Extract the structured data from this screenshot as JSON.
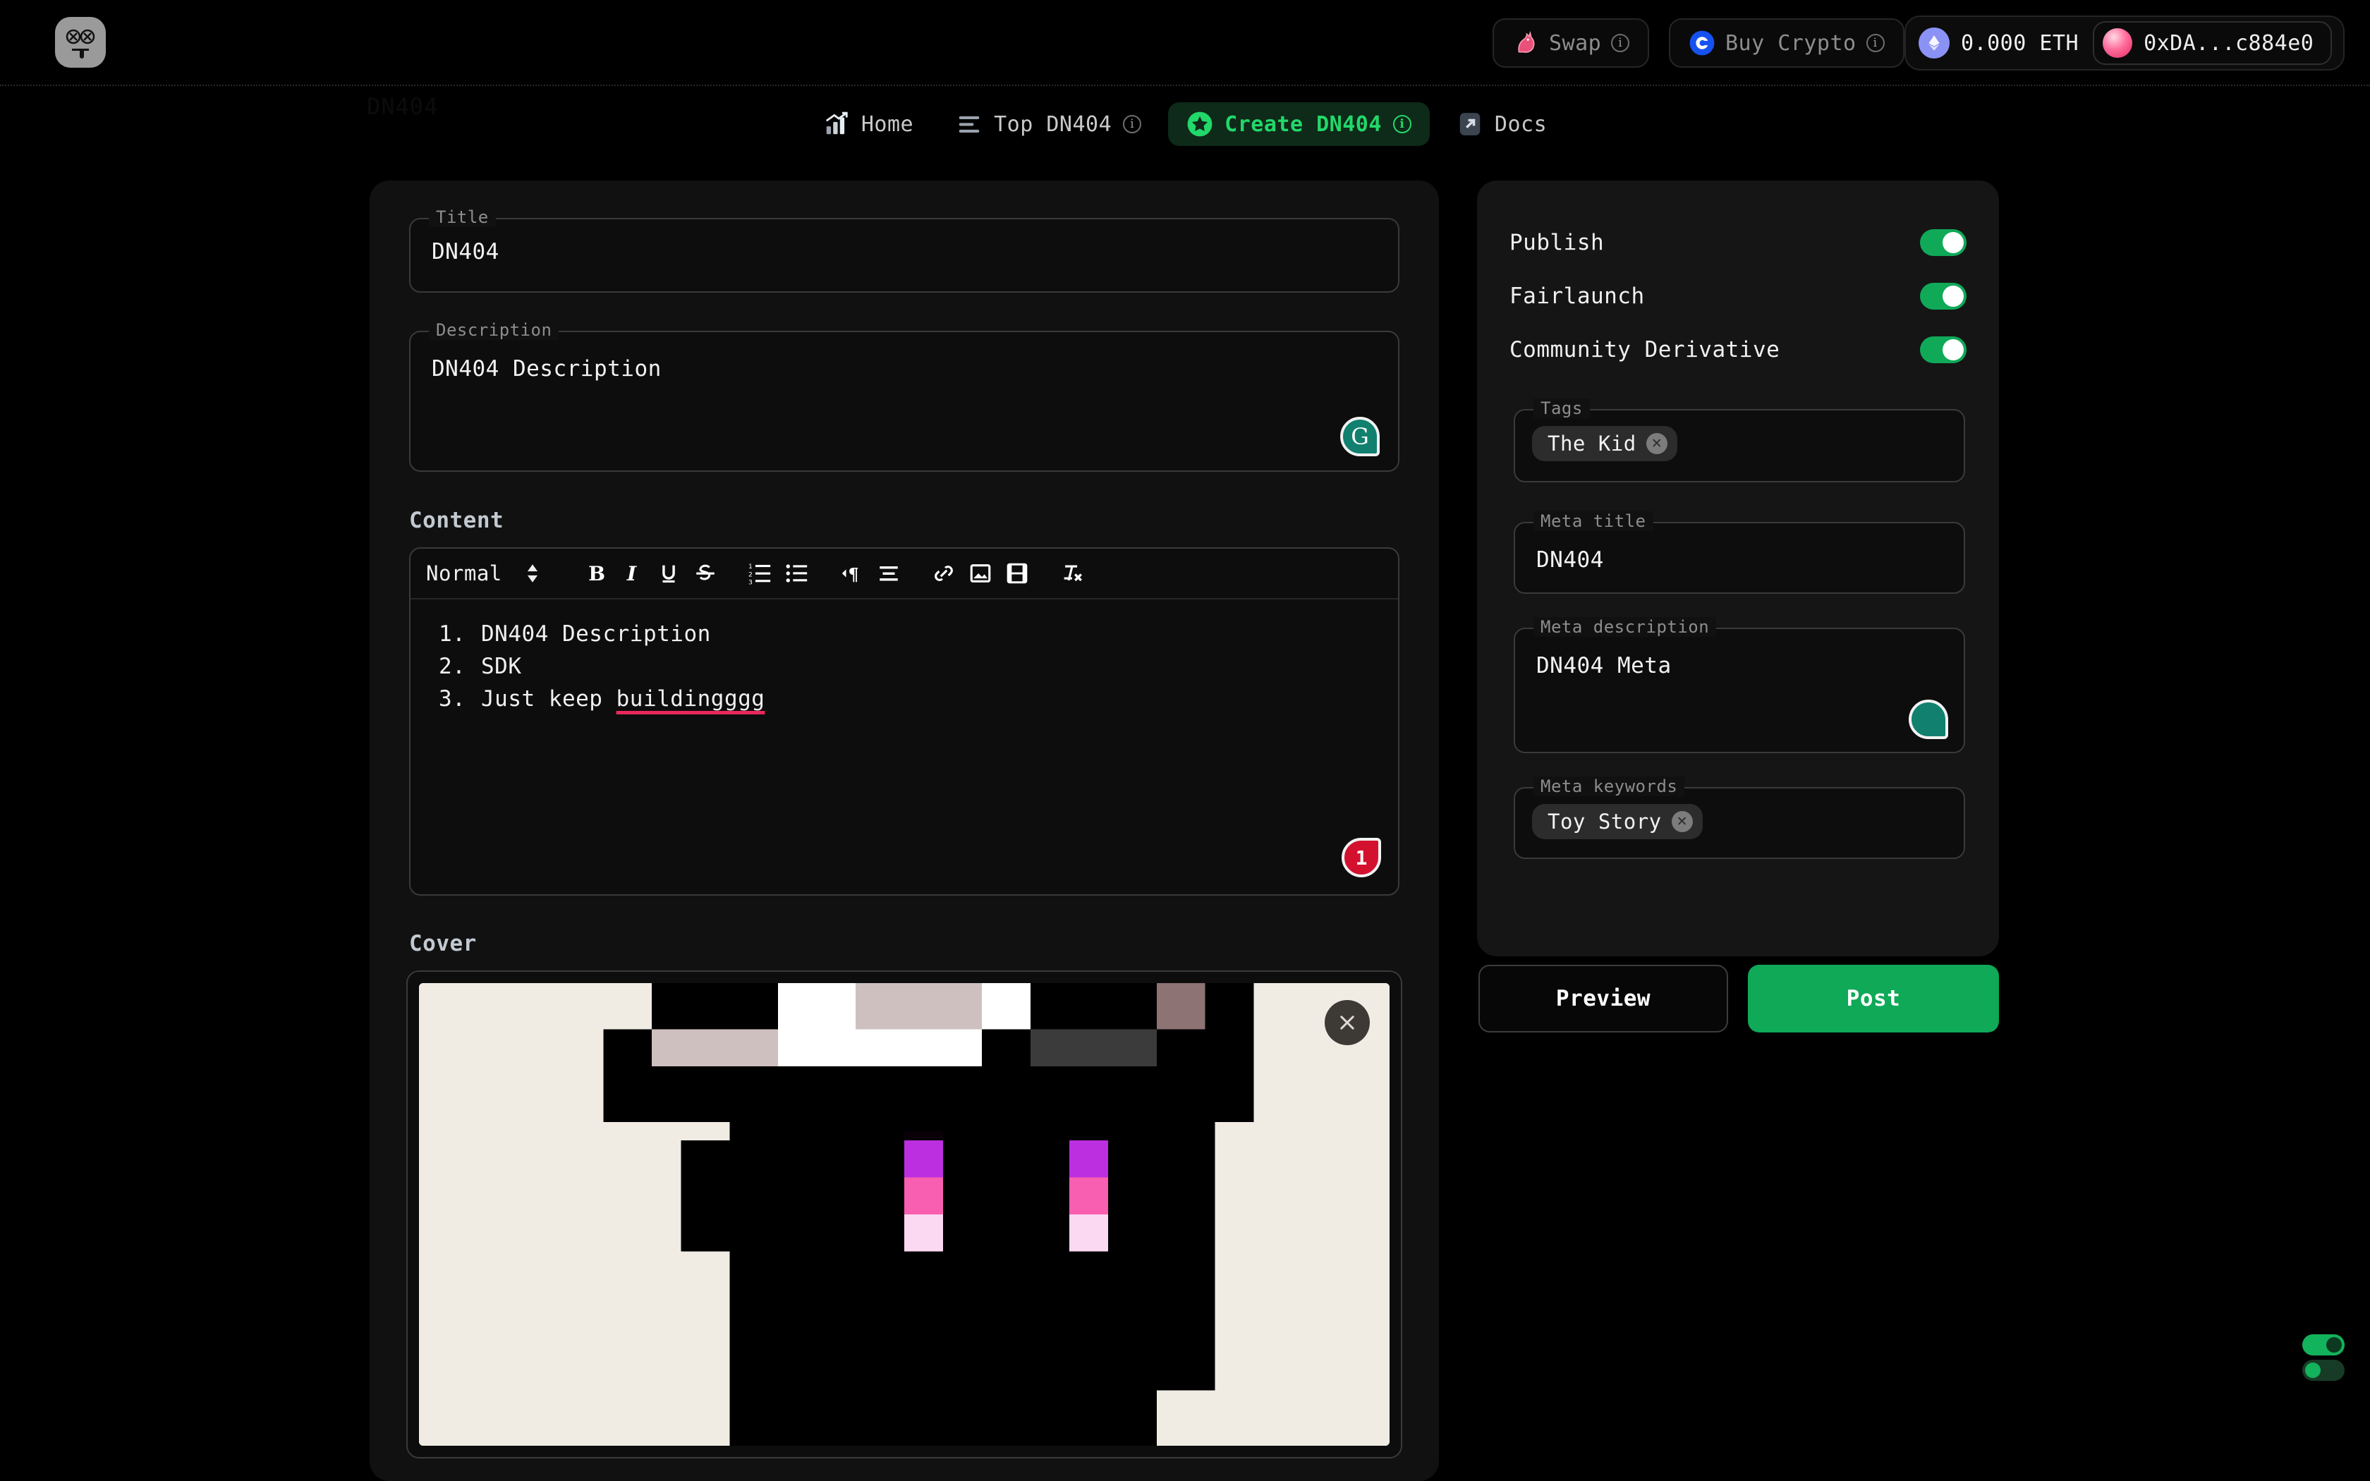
{
  "topbar": {
    "logo_icon": "dead-face-logo-icon",
    "swap": {
      "label": "Swap",
      "icon": "unicorn-icon",
      "info_icon": "info-icon"
    },
    "buy_crypto": {
      "label": "Buy Crypto",
      "icon": "coinbase-icon",
      "info_icon": "info-icon"
    },
    "wallet": {
      "balance": "0.000 ETH",
      "chain_icon": "ethereum-icon",
      "address": "0xDA...c884e0",
      "avatar_icon": "wallet-avatar"
    }
  },
  "nav": {
    "items": [
      {
        "label": "Home",
        "icon": "chart-up-icon",
        "active": false,
        "has_info": false
      },
      {
        "label": "Top DN404",
        "icon": "list-icon",
        "active": false,
        "has_info": true
      },
      {
        "label": "Create DN404",
        "icon": "star-badge-icon",
        "active": true,
        "has_info": true
      },
      {
        "label": "Docs",
        "icon": "external-link-icon",
        "active": false,
        "has_info": false
      }
    ]
  },
  "ghost_text": "DN404",
  "form": {
    "title": {
      "legend": "Title",
      "value": "DN404"
    },
    "description": {
      "legend": "Description",
      "value": "DN404 Description",
      "grammarly_icon": "grammarly-icon"
    },
    "content": {
      "label": "Content",
      "toolbar": {
        "style_select": "Normal",
        "style_caret_icon": "chevron-updown-icon",
        "buttons": [
          "bold-icon",
          "italic-icon",
          "underline-icon",
          "strikethrough-icon",
          "ordered-list-icon",
          "bullet-list-icon",
          "text-direction-icon",
          "align-icon",
          "link-icon",
          "image-icon",
          "video-icon",
          "clear-format-icon"
        ]
      },
      "items": [
        {
          "num": "1.",
          "text": "DN404 Description",
          "misspelled": ""
        },
        {
          "num": "2.",
          "text": "SDK",
          "misspelled": ""
        },
        {
          "num": "3.",
          "text": "Just keep ",
          "misspelled": "buildingggg"
        }
      ],
      "grammarly_count": "1"
    },
    "cover": {
      "label": "Cover",
      "remove_icon": "close-icon",
      "image_alt": "pixel-art-character-cover"
    }
  },
  "sidebar": {
    "toggles": [
      {
        "label": "Publish",
        "on": true
      },
      {
        "label": "Fairlaunch",
        "on": true
      },
      {
        "label": "Community Derivative",
        "on": true
      }
    ],
    "tags": {
      "legend": "Tags",
      "chips": [
        {
          "label": "The Kid",
          "remove_icon": "chip-close-icon"
        }
      ]
    },
    "meta_title": {
      "legend": "Meta title",
      "value": "DN404"
    },
    "meta_description": {
      "legend": "Meta description",
      "value": "DN404 Meta",
      "grammarly_icon": "grammarly-icon"
    },
    "meta_keywords": {
      "legend": "Meta keywords",
      "chips": [
        {
          "label": "Toy Story",
          "remove_icon": "chip-close-icon"
        }
      ]
    },
    "preview_label": "Preview",
    "post_label": "Post"
  },
  "colors": {
    "accent_green": "#0fa958",
    "nav_active_green": "#22d86a",
    "spellcheck_red": "#e8275a",
    "grammarly_teal": "#11806f",
    "grammarly_count_red": "#d3112f",
    "page_background": "#000000",
    "panel_background": "#111111",
    "side_panel_background": "#151515"
  },
  "theme_widget": {
    "name": "theme-toggle-widget"
  }
}
